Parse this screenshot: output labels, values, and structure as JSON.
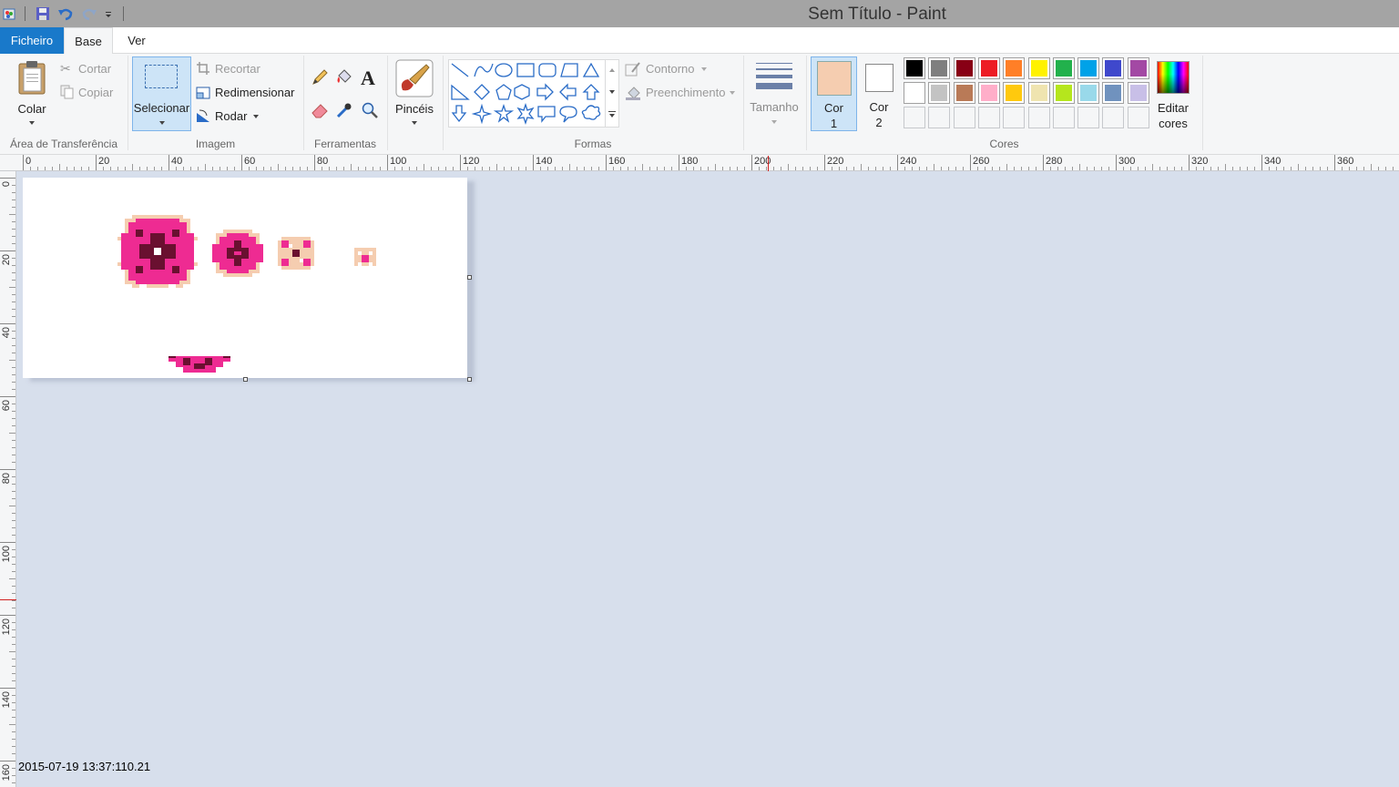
{
  "window": {
    "title": "Sem Título - Paint"
  },
  "tabs": [
    {
      "label": "Ficheiro"
    },
    {
      "label": "Base"
    },
    {
      "label": "Ver"
    }
  ],
  "clipboard": {
    "paste_label": "Colar",
    "cut_label": "Cortar",
    "copy_label": "Copiar",
    "group_label": "Área de Transferência"
  },
  "image": {
    "select_label": "Selecionar",
    "crop_label": "Recortar",
    "resize_label": "Redimensionar",
    "rotate_label": "Rodar",
    "group_label": "Imagem"
  },
  "tools": {
    "group_label": "Ferramentas"
  },
  "brushes": {
    "label": "Pincéis"
  },
  "shapes": {
    "outline_label": "Contorno",
    "fill_label": "Preenchimento",
    "group_label": "Formas"
  },
  "size": {
    "label": "Tamanho"
  },
  "colors": {
    "color1_line1": "Cor",
    "color1_line2": "1",
    "color2_line1": "Cor",
    "color2_line2": "2",
    "edit_line1": "Editar",
    "edit_line2": "cores",
    "group_label": "Cores",
    "color1_value": "#f5cdb0",
    "color2_value": "#ffffff",
    "palette_row1": [
      "#000000",
      "#7f7f7f",
      "#880015",
      "#ed1c24",
      "#ff7f27",
      "#fff200",
      "#22b14c",
      "#00a2e8",
      "#3f48cc",
      "#a349a4"
    ],
    "palette_row2": [
      "#ffffff",
      "#c3c3c3",
      "#b97a57",
      "#ffaec9",
      "#ffc90e",
      "#efe4b0",
      "#b5e61d",
      "#99d9ea",
      "#7092be",
      "#c8bfe7"
    ]
  },
  "ruler_top_ticks": [
    "0",
    "20",
    "40",
    "60",
    "80",
    "100",
    "120",
    "140",
    "160",
    "180",
    "200",
    "220",
    "240",
    "260",
    "280",
    "300",
    "320",
    "340",
    "360"
  ],
  "ruler_left_ticks": [
    "0",
    "20",
    "40",
    "60",
    "80",
    "100",
    "120",
    "140",
    "160"
  ],
  "status": {
    "text": "2015-07-19 13:37:110.21"
  },
  "icons": {
    "paste": "clipboard-icon",
    "cut": "scissors-icon",
    "copy": "copy-icon",
    "crop": "crop-icon",
    "resize": "resize-icon",
    "rotate": "rotate-icon",
    "pencil": "pencil-icon",
    "fill": "bucket-icon",
    "text": "text-icon",
    "eraser": "eraser-icon",
    "picker": "color-picker-icon",
    "magnifier": "magnifier-icon"
  }
}
